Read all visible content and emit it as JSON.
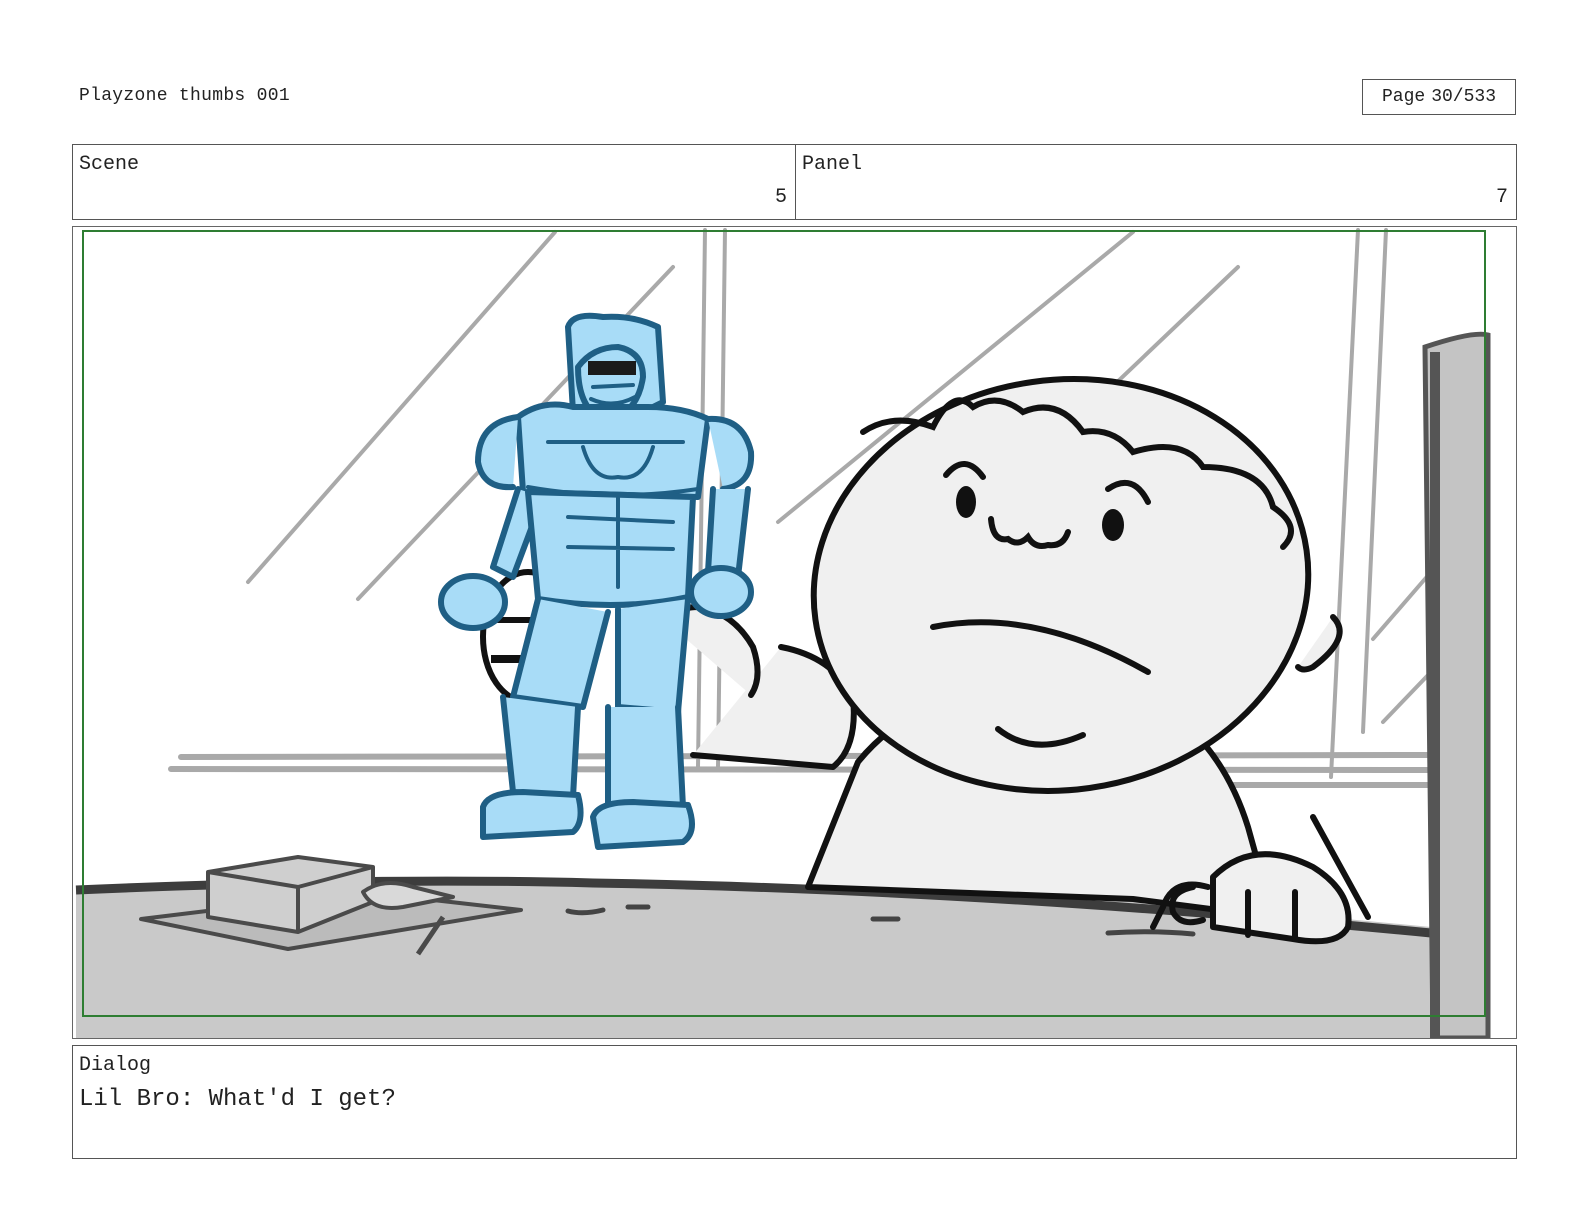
{
  "header": {
    "doc_title": "Playzone thumbs 001",
    "page_label": "Page",
    "page_value": "30/533"
  },
  "info": {
    "scene_label": "Scene",
    "scene_value": "5",
    "panel_label": "Panel",
    "panel_value": "7"
  },
  "dialog": {
    "label": "Dialog",
    "text": "Lil Bro: What'd I get?"
  },
  "colors": {
    "safe_frame": "#2e7d32",
    "robot_fill": "#a8dcf7",
    "robot_line": "#1f5f85",
    "table_fill": "#c9c9c9",
    "skin_fill": "#f0f0f0"
  }
}
